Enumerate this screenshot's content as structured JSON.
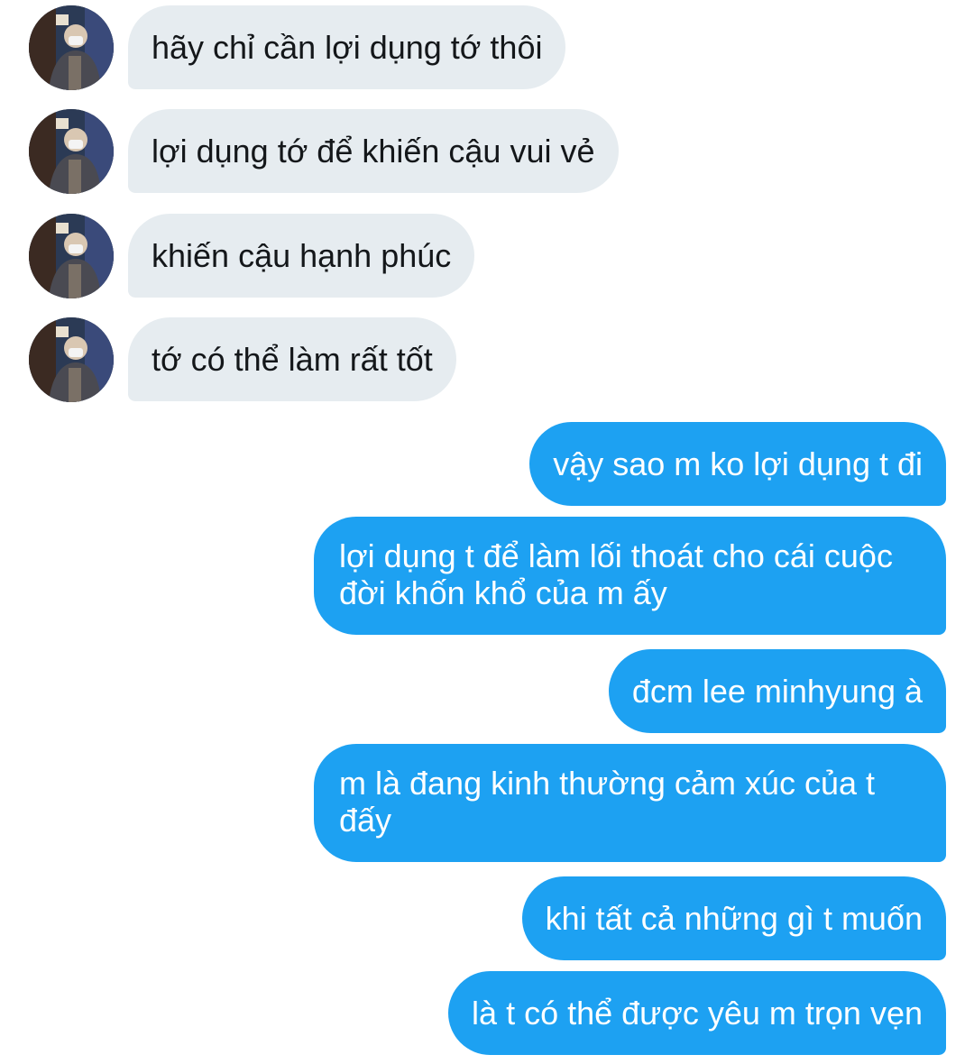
{
  "messages": [
    {
      "sender": "them",
      "text": "hãy chỉ cần lợi dụng tớ thôi"
    },
    {
      "sender": "them",
      "text": "lợi dụng tớ để khiến cậu vui vẻ"
    },
    {
      "sender": "them",
      "text": "khiến cậu hạnh phúc"
    },
    {
      "sender": "them",
      "text": "tớ có thể làm rất tốt"
    },
    {
      "sender": "me",
      "text": "vậy sao m ko lợi dụng t đi"
    },
    {
      "sender": "me",
      "text": "lợi dụng t để làm lối thoát cho cái cuộc đời khốn khổ của m ấy"
    },
    {
      "sender": "me",
      "text": "đcm lee minhyung à"
    },
    {
      "sender": "me",
      "text": "m là đang kinh thường cảm xúc của t đấy"
    },
    {
      "sender": "me",
      "text": "khi tất cả những gì t muốn"
    },
    {
      "sender": "me",
      "text": "là t có thể được yêu m trọn vẹn"
    }
  ],
  "colors": {
    "incoming_bubble": "#e6ecf0",
    "incoming_text": "#14171a",
    "outgoing_bubble": "#1da1f2",
    "outgoing_text": "#ffffff"
  },
  "icons": {
    "avatar": "user-avatar-photo"
  }
}
